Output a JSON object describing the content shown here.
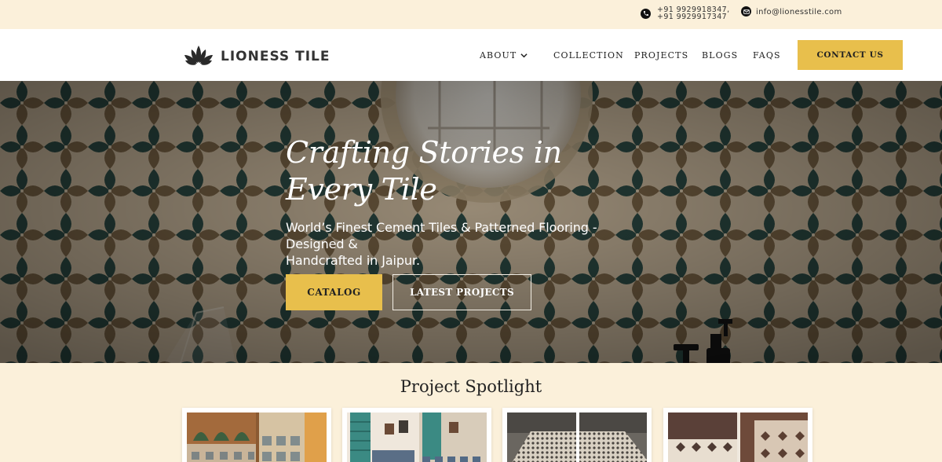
{
  "topbar": {
    "phone_icon": "phone-icon",
    "phone_line_1": "+91 9929918347,",
    "phone_line_2": "+91 9929917347",
    "email_icon": "envelope-icon",
    "email": "info@lionesstile.com"
  },
  "header": {
    "logo_icon": "lotus-icon",
    "brand": "LIONESS TILE",
    "nav": {
      "about": "ABOUT",
      "collection": "COLLECTION",
      "projects": "PROJECTS",
      "blogs": "BLOGS",
      "faqs": "FAQS"
    },
    "cta": "CONTACT US"
  },
  "hero": {
    "title_line_1": "Crafting Stories in",
    "title_line_2": "Every Tile",
    "subtitle_line_1": "World’s Finest Cement Tiles & Patterned Flooring - Designed &",
    "subtitle_line_2": "Handcrafted in Jaipur.",
    "catalog_button": "CATALOG",
    "projects_button": "LATEST PROJECTS"
  },
  "spotlight": {
    "title": "Project Spotlight"
  },
  "colors": {
    "accent": "#e8bf4c",
    "cream": "#fbf0da",
    "tile_teal": "#2c4a44",
    "tile_tan": "#8a7353"
  }
}
